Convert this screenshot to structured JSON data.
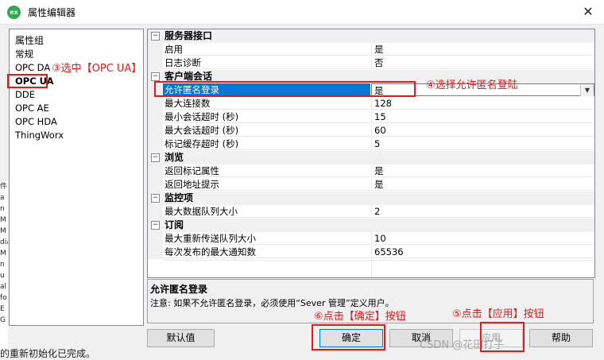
{
  "window": {
    "title": "属性编辑器",
    "icon": "ex-logo-icon",
    "close_label": "✕"
  },
  "groups": {
    "header": "属性组",
    "items": [
      "常规",
      "OPC DA",
      "OPC UA",
      "DDE",
      "OPC AE",
      "OPC HDA",
      "ThingWorx"
    ],
    "selected": "OPC UA"
  },
  "properties": {
    "rows": [
      {
        "type": "cat",
        "name": "服务器接口"
      },
      {
        "type": "prop",
        "name": "启用",
        "value": "是"
      },
      {
        "type": "prop",
        "name": "日志诊断",
        "value": "否"
      },
      {
        "type": "cat",
        "name": "客户端会话"
      },
      {
        "type": "prop",
        "name": "允许匿名登录",
        "value": "是",
        "selected": true
      },
      {
        "type": "prop",
        "name": "最大连接数",
        "value": "128"
      },
      {
        "type": "prop",
        "name": "最小会话超时 (秒)",
        "value": "15"
      },
      {
        "type": "prop",
        "name": "最大会话超时 (秒)",
        "value": "60"
      },
      {
        "type": "prop",
        "name": "标记缓存超时 (秒)",
        "value": "5"
      },
      {
        "type": "cat",
        "name": "浏览"
      },
      {
        "type": "prop",
        "name": "返回标记属性",
        "value": "是"
      },
      {
        "type": "prop",
        "name": "返回地址提示",
        "value": "是"
      },
      {
        "type": "cat",
        "name": "监控项"
      },
      {
        "type": "prop",
        "name": "最大数据队列大小",
        "value": "2"
      },
      {
        "type": "cat",
        "name": "订阅"
      },
      {
        "type": "prop",
        "name": "最大重新传送队列大小",
        "value": "10"
      },
      {
        "type": "prop",
        "name": "每次发布的最大通知数",
        "value": "65536"
      }
    ]
  },
  "description": {
    "title": "允许匿名登录",
    "text": "注意: 如果不允许匿名登录，必须使用“Sever 管理”定义用户。"
  },
  "buttons": {
    "defaults": "默认值",
    "ok": "确定",
    "cancel": "取消",
    "apply": "应用",
    "help": "帮助"
  },
  "annotations": {
    "a3": "③选中【OPC UA】",
    "a4": "④选择允许匿名登陆",
    "a5": "⑤点击【应用】按钮",
    "a6": "⑥点击【确定】按钮",
    "color": "#e31a1a"
  },
  "background": {
    "left_strip": [
      "件",
      "a",
      "n",
      "M",
      "M",
      "dia",
      "M",
      "n",
      "u",
      "al",
      "fo",
      "E",
      "G"
    ],
    "bottom_text": "的重新初始化已完成。"
  },
  "watermark": "CSDN @花田打子"
}
